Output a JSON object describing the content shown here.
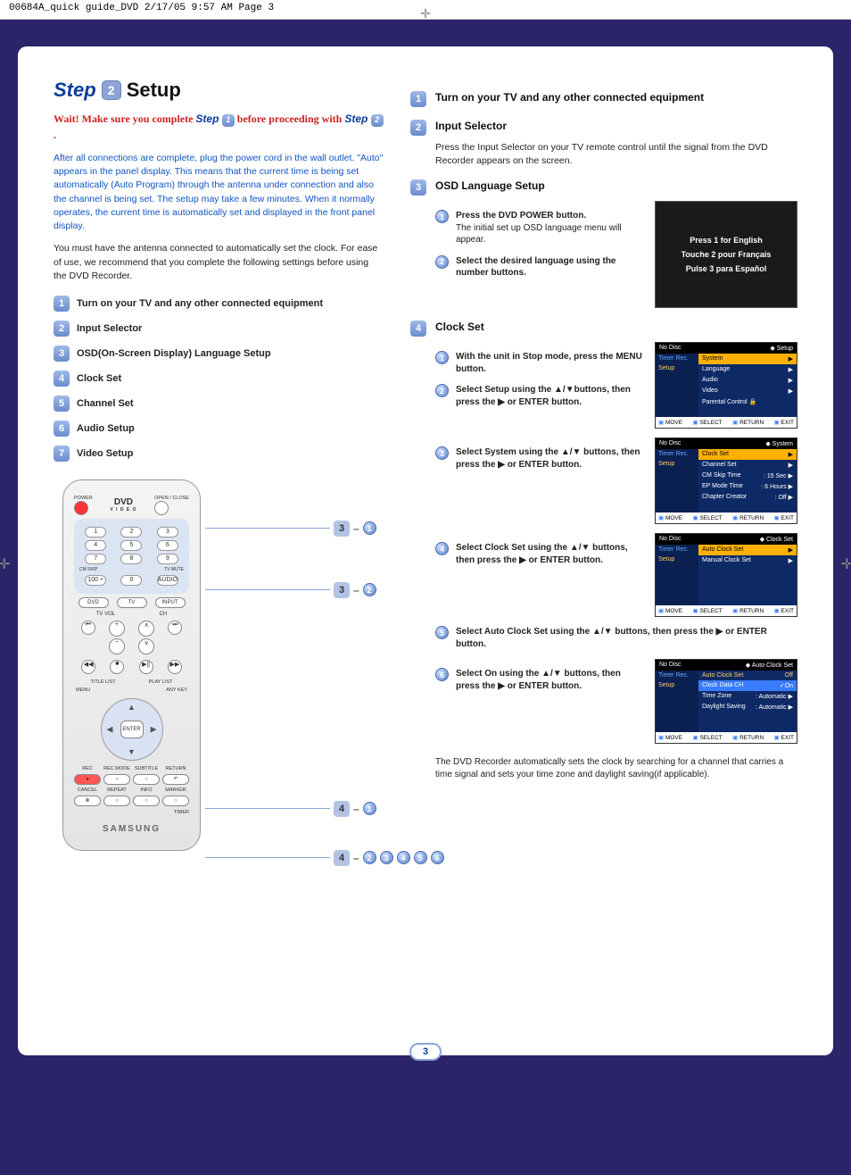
{
  "print_header": "00684A_quick guide_DVD  2/17/05  9:57 AM  Page 3",
  "step": {
    "word": "Step",
    "num": "2",
    "title": "Setup"
  },
  "wait": {
    "prefix": "Wait! Make sure you complete ",
    "step_word": "Step",
    "one": "1",
    "mid": " before proceeding with ",
    "two": "2",
    "suffix": " ."
  },
  "blue_para": "After all connections are complete, plug the power cord in the wall outlet. \"Auto\" appears in the panel display. This means that the current time is being set automatically (Auto Program) through the antenna under connection and also the channel is being set. The setup may take a few minutes. When it normally operates, the current time is automatically set and displayed in the front panel display.",
  "black_para": "You must have the antenna connected to automatically set the clock. For ease of use, we recommend that you complete the following settings before using the DVD Recorder.",
  "checklist": [
    {
      "n": "1",
      "t": "Turn on your TV and any other connected equipment"
    },
    {
      "n": "2",
      "t": "Input Selector"
    },
    {
      "n": "3",
      "t": "OSD(On-Screen Display) Language Setup"
    },
    {
      "n": "4",
      "t": "Clock Set"
    },
    {
      "n": "5",
      "t": "Channel Set"
    },
    {
      "n": "6",
      "t": "Audio Setup"
    },
    {
      "n": "7",
      "t": "Video Setup"
    }
  ],
  "remote": {
    "power": "POWER",
    "openclose": "OPEN / CLOSE",
    "dvd_logo": "DVD",
    "video_label": "V I D E O",
    "cmskip": "CM SKIP",
    "tvmute": "TV MUTE",
    "hundred": "100 +",
    "audio": "AUDIO",
    "dvd": "DVD",
    "tv": "TV",
    "input": "INPUT",
    "tvvol": "TV VOL",
    "ch": "CH",
    "titlelist": "TITLE LIST",
    "playlist": "PLAY LIST",
    "menu": "MENU",
    "anykey": "ANY KEY",
    "enter": "ENTER",
    "rec": "REC",
    "recmode": "REC MODE",
    "subtitle": "SUBTITLE",
    "return": "RETURN",
    "cancel": "CANCEL",
    "repeat": "REPEAT",
    "info": "INFO",
    "marker": "MARKER",
    "timer": "TIMER",
    "brand": "SAMSUNG"
  },
  "callouts": {
    "c31": {
      "big": "3",
      "small": "1"
    },
    "c32": {
      "big": "3",
      "small": "2"
    },
    "c41": {
      "big": "4",
      "small": "1"
    },
    "c4m": {
      "big": "4",
      "smalls": [
        "2",
        "3",
        "4",
        "5",
        "6"
      ]
    }
  },
  "right": {
    "s1": {
      "n": "1",
      "title": "Turn on your TV and any other connected equipment"
    },
    "s2": {
      "n": "2",
      "title": "Input Selector",
      "body": "Press the Input Selector on your TV remote control until the signal from the DVD Recorder appears on the screen."
    },
    "s3": {
      "n": "3",
      "title": "OSD Language Setup",
      "sub1": {
        "n": "1",
        "bold": "Press the DVD POWER button.",
        "rest": "The initial set up OSD language menu will appear."
      },
      "sub2": {
        "n": "2",
        "text": "Select the desired language using the number buttons."
      },
      "lang_box": [
        "Press 1 for English",
        "Touche 2 pour Français",
        "Pulse 3 para Español"
      ]
    },
    "s4": {
      "n": "4",
      "title": "Clock Set",
      "sub1": {
        "n": "1",
        "text": "With the unit in Stop mode, press the MENU button."
      },
      "sub2": {
        "n": "2",
        "text": "Select Setup using the ▲/▼buttons, then press the ▶ or ENTER button."
      },
      "sub3": {
        "n": "3",
        "text": "Select System using the ▲/▼ buttons, then press the ▶ or ENTER button."
      },
      "sub4": {
        "n": "4",
        "text": "Select Clock Set using the ▲/▼ buttons, then press the ▶ or ENTER button."
      },
      "sub5": {
        "n": "5",
        "text": "Select Auto Clock Set using the ▲/▼ buttons, then press the ▶ or ENTER button."
      },
      "sub6": {
        "n": "6",
        "text": "Select On using the ▲/▼ buttons, then press the ▶ or ENTER button."
      },
      "osd_setup": {
        "header_l": "No Disc",
        "header_r": "Setup",
        "left": [
          "Timer Rec.",
          "Setup"
        ],
        "rows": [
          [
            "System",
            "▶"
          ],
          [
            "Language",
            "▶"
          ],
          [
            "Audio",
            "▶"
          ],
          [
            "Video",
            "▶"
          ],
          [
            "Parental Control 🔒",
            ""
          ]
        ],
        "hl": 0,
        "footer": [
          "MOVE",
          "SELECT",
          "RETURN",
          "EXIT"
        ]
      },
      "osd_system": {
        "header_l": "No Disc",
        "header_r": "System",
        "left": [
          "Timer Rec.",
          "Setup"
        ],
        "rows": [
          [
            "Clock Set",
            "▶"
          ],
          [
            "Channel Set",
            "▶"
          ],
          [
            "CM Skip Time",
            ": 15 Sec   ▶"
          ],
          [
            "EP Mode Time",
            ": 6 Hours  ▶"
          ],
          [
            "Chapter Creator",
            ": Off        ▶"
          ]
        ],
        "hl": 0,
        "footer": [
          "MOVE",
          "SELECT",
          "RETURN",
          "EXIT"
        ]
      },
      "osd_clock": {
        "header_l": "No Disc",
        "header_r": "Clock Set",
        "left": [
          "Timer Rec.",
          "Setup"
        ],
        "rows": [
          [
            "Auto Clock Set",
            "▶"
          ],
          [
            "Manual Clock Set",
            "▶"
          ]
        ],
        "hl": 0,
        "footer": [
          "MOVE",
          "SELECT",
          "RETURN",
          "EXIT"
        ]
      },
      "osd_auto": {
        "header_l": "No Disc",
        "header_r": "Auto Clock Set",
        "left": [
          "Timer Rec.",
          "Setup"
        ],
        "rows": [
          [
            "Auto Clock Set",
            "Off"
          ],
          [
            "Clock Data CH",
            "✓On"
          ],
          [
            "Time Zone",
            ": Automatic  ▶"
          ],
          [
            "Daylight Saving",
            ": Automatic  ▶"
          ]
        ],
        "hl": 1,
        "orange": 0,
        "footer": [
          "MOVE",
          "SELECT",
          "RETURN",
          "EXIT"
        ]
      }
    },
    "footnote": "The DVD Recorder automatically sets the clock by searching for a channel that carries a time signal and sets your time zone and daylight saving(if applicable).",
    "page_number": "3"
  }
}
